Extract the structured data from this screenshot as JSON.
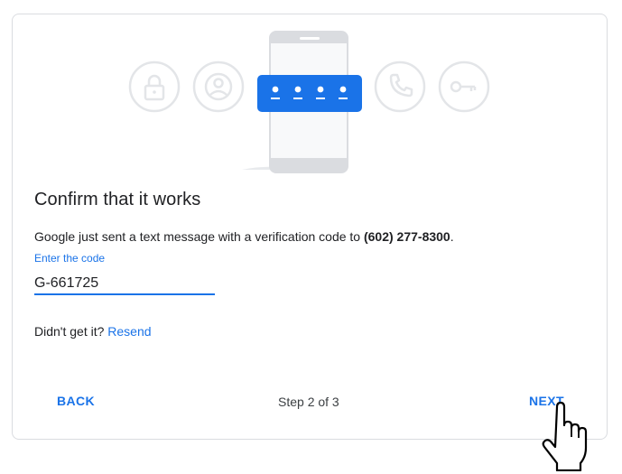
{
  "illustration": {
    "icons": [
      "lock-icon",
      "account-icon",
      "phone-icon",
      "key-icon"
    ],
    "colors": {
      "accent": "#1a73e8",
      "icon_stroke": "#e8eaed",
      "phone_body": "#f1f3f4",
      "phone_frame": "#dadce0"
    }
  },
  "title": "Confirm that it works",
  "description": {
    "prefix": "Google just sent a text message with a verification code to ",
    "phone": "(602) 277-8300",
    "suffix": "."
  },
  "code_field": {
    "label": "Enter the code",
    "value": "G-661725"
  },
  "resend": {
    "prompt": "Didn't get it? ",
    "link": "Resend"
  },
  "footer": {
    "back_label": "BACK",
    "step_text": "Step 2 of 3",
    "next_label": "NEXT"
  }
}
